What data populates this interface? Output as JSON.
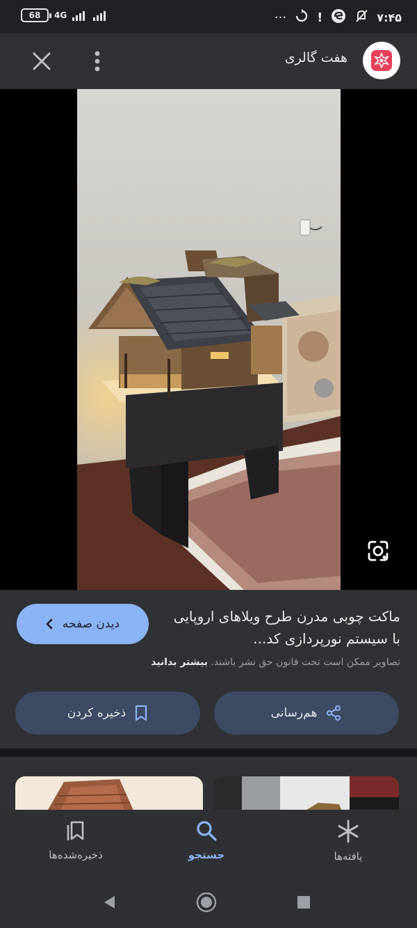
{
  "status": {
    "battery": "68",
    "network": "4G",
    "time": "۷:۴۵",
    "icons": [
      "overflow-dots-icon",
      "sync-icon",
      "alert-icon",
      "edge-icon",
      "mute-icon"
    ]
  },
  "header": {
    "site_name": "هفت گالری",
    "logo_icon": "haft-gallery-logo",
    "close_icon": "close-icon",
    "menu_icon": "more-vert-icon"
  },
  "info": {
    "visit_label": "دیدن صفحه",
    "title": "ماکت چوبی مدرن طرح ویلاهای اروپایی با سیستم نورپردازی کد...",
    "copyright_text": "تصاویر ممکن است تحت قانون حق نشر باشند.",
    "learn_more": "بیشتر بدانید",
    "share_label": "هم‌رسانی",
    "save_label": "ذخیره کردن"
  },
  "bottom_nav": {
    "discover": "یافته‌ها",
    "search": "جستجو",
    "saved": "ذخیره‌شده‌ها",
    "active": "search"
  },
  "colors": {
    "background": "#202124",
    "panel": "#303134",
    "accent": "#8ab4f8",
    "action_button": "#3c4a63",
    "logo_accent": "#e8405a"
  }
}
